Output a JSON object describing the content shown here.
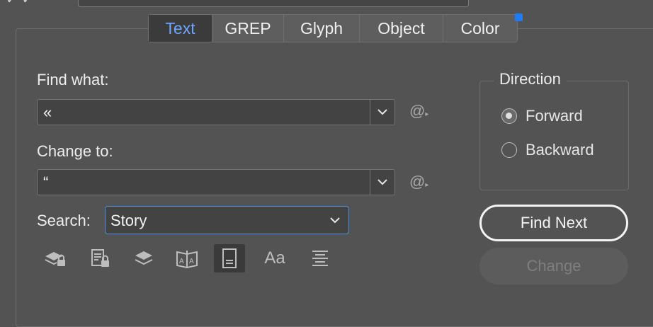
{
  "top": {
    "left_text": "✓ ✓"
  },
  "tabs": [
    {
      "label": "Text",
      "active": true
    },
    {
      "label": "GREP",
      "active": false
    },
    {
      "label": "Glyph",
      "active": false
    },
    {
      "label": "Object",
      "active": false
    },
    {
      "label": "Color",
      "active": false
    }
  ],
  "find": {
    "label": "Find what:",
    "value": "«",
    "special_icon": "@"
  },
  "change": {
    "label": "Change to:",
    "value": "“",
    "special_icon": "@"
  },
  "search": {
    "label": "Search:",
    "value": "Story"
  },
  "direction": {
    "title": "Direction",
    "options": [
      {
        "label": "Forward",
        "checked": true
      },
      {
        "label": "Backward",
        "checked": false
      }
    ]
  },
  "buttons": {
    "find_next": "Find Next",
    "change": "Change"
  },
  "options_toolbar": {
    "items": [
      {
        "icon": "locked-layers-icon"
      },
      {
        "icon": "locked-stories-icon"
      },
      {
        "icon": "hidden-layers-icon"
      },
      {
        "icon": "master-pages-icon"
      },
      {
        "icon": "footnotes-icon",
        "active": true
      },
      {
        "icon": "case-sensitive-icon",
        "text": "Aa"
      },
      {
        "icon": "whole-word-icon"
      }
    ]
  },
  "colors": {
    "accent": "#6ea6ff",
    "focus": "#4a90e2",
    "badge": "#1f7cf2",
    "panel": "#535353"
  }
}
